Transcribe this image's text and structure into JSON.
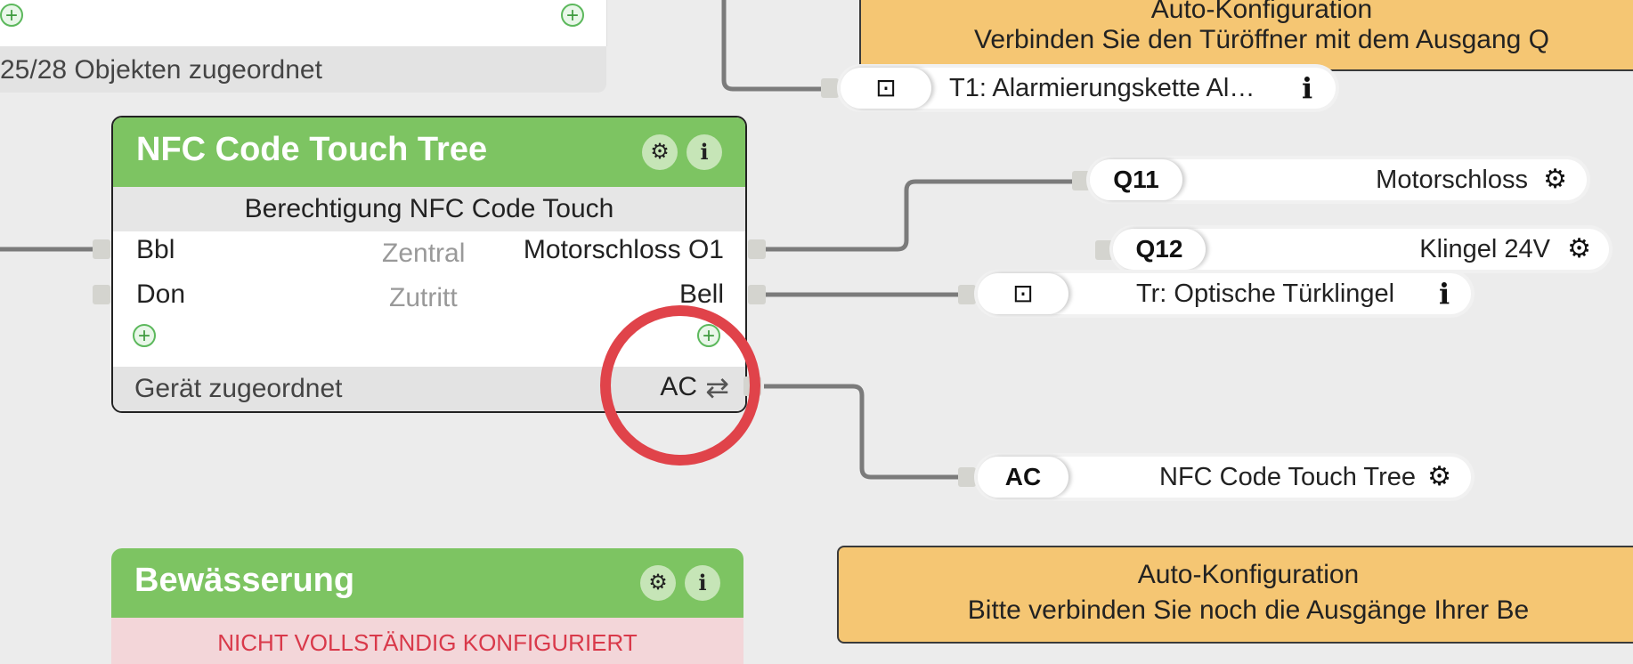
{
  "top_block": {
    "footer_text": "25/28 Objekten zugeordnet",
    "add_left": "+",
    "add_right": "+"
  },
  "nfc_node": {
    "title": "NFC Code Touch Tree",
    "subtitle": "Berechtigung NFC Code Touch",
    "inputs": [
      {
        "label": "Bbl",
        "type": "Zentral"
      },
      {
        "label": "Don",
        "type": "Zutritt"
      }
    ],
    "outputs": [
      {
        "label": "Motorschloss O1"
      },
      {
        "label": "Bell"
      }
    ],
    "add_symbol": "+",
    "footer_status": "Gerät zugeordnet",
    "footer_ac": "AC",
    "swap_symbol": "⇄",
    "settings_symbol": "⚙",
    "info_symbol": "i"
  },
  "connectors": [
    {
      "tag": "",
      "text": "T1: Alarmierungskette Al…",
      "icon": "info"
    },
    {
      "tag": "Q11",
      "text": "Motorschloss",
      "icon": "gear"
    },
    {
      "tag": "Q12",
      "text": "Klingel 24V",
      "icon": "gear"
    },
    {
      "tag": "",
      "text": "Tr: Optische Türklingel",
      "icon": "info"
    },
    {
      "tag": "AC",
      "text": "NFC Code Touch Tree",
      "icon": "gear"
    }
  ],
  "connector_icons": {
    "gear": "⚙",
    "info": "i",
    "input": "⊡"
  },
  "banners": {
    "top": {
      "title": "Auto-Konfiguration",
      "text": "Verbinden Sie den Türöffner mit dem Ausgang Q"
    },
    "bottom": {
      "title": "Auto-Konfiguration",
      "text": "Bitte verbinden Sie noch die Ausgänge Ihrer Be"
    }
  },
  "bew_node": {
    "title": "Bewässerung",
    "warning": "NICHT VOLLSTÄNDIG KONFIGURIERT"
  },
  "colors": {
    "node_header": "#7dc462",
    "banner": "#f5c673",
    "warning_text": "#d9394a",
    "highlight": "#e0434a"
  }
}
